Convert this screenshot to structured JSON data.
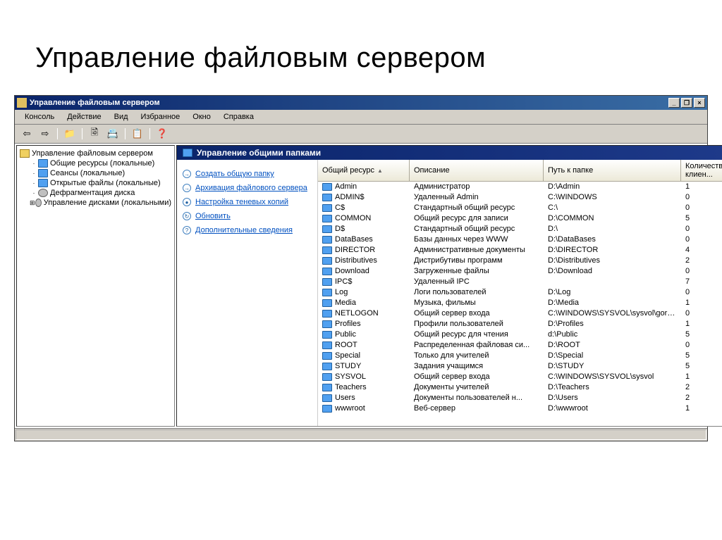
{
  "slide_title": "Управление файловым сервером",
  "window": {
    "title": "Управление файловым сервером",
    "min": "_",
    "max": "□",
    "restore": "❐",
    "close": "×"
  },
  "menu": {
    "console": "Консоль",
    "action": "Действие",
    "view": "Вид",
    "favorites": "Избранное",
    "window": "Окно",
    "help": "Справка"
  },
  "tree": {
    "root": "Управление файловым сервером",
    "items": [
      "Общие ресурсы (локальные)",
      "Сеансы (локальные)",
      "Открытые файлы (локальные)",
      "Дефрагментация диска",
      "Управление дисками (локальными)"
    ]
  },
  "content_header": "Управление общими папками",
  "actions": [
    {
      "icon": "→",
      "label": "Создать общую папку"
    },
    {
      "icon": "→",
      "label": "Архивация файлового сервера"
    },
    {
      "icon": "●",
      "label": "Настройка теневых копий"
    },
    {
      "icon": "↻",
      "label": "Обновить"
    },
    {
      "icon": "?",
      "label": "Дополнительные сведения"
    }
  ],
  "columns": {
    "name": "Общий ресурс",
    "desc": "Описание",
    "path": "Путь к папке",
    "count": "Количество клиен..."
  },
  "shares": [
    {
      "name": "Admin",
      "desc": "Администратор",
      "path": "D:\\Admin",
      "count": "1"
    },
    {
      "name": "ADMIN$",
      "desc": "Удаленный Admin",
      "path": "C:\\WINDOWS",
      "count": "0"
    },
    {
      "name": "C$",
      "desc": "Стандартный общий ресурс",
      "path": "C:\\",
      "count": "0"
    },
    {
      "name": "COMMON",
      "desc": "Общий ресурс для записи",
      "path": "D:\\COMMON",
      "count": "5"
    },
    {
      "name": "D$",
      "desc": "Стандартный общий ресурс",
      "path": "D:\\",
      "count": "0"
    },
    {
      "name": "DataBases",
      "desc": "Базы данных через WWW",
      "path": "D:\\DataBases",
      "count": "0"
    },
    {
      "name": "DIRECTOR",
      "desc": "Административные документы",
      "path": "D:\\DIRECTOR",
      "count": "4"
    },
    {
      "name": "Distributives",
      "desc": "Дистрибутивы программ",
      "path": "D:\\Distributives",
      "count": "2"
    },
    {
      "name": "Download",
      "desc": "Загруженные файлы",
      "path": "D:\\Download",
      "count": "0"
    },
    {
      "name": "IPC$",
      "desc": "Удаленный IPC",
      "path": "",
      "count": "7"
    },
    {
      "name": "Log",
      "desc": "Логи пользователей",
      "path": "D:\\Log",
      "count": "0"
    },
    {
      "name": "Media",
      "desc": "Музыка, фильмы",
      "path": "D:\\Media",
      "count": "1"
    },
    {
      "name": "NETLOGON",
      "desc": "Общий сервер входа",
      "path": "C:\\WINDOWS\\SYSVOL\\sysvol\\gorchak...",
      "count": "0"
    },
    {
      "name": "Profiles",
      "desc": "Профили пользователей",
      "path": "D:\\Profiles",
      "count": "1"
    },
    {
      "name": "Public",
      "desc": "Общий ресурс для чтения",
      "path": "d:\\Public",
      "count": "5"
    },
    {
      "name": "ROOT",
      "desc": "Распределенная файловая си...",
      "path": "D:\\ROOT",
      "count": "0"
    },
    {
      "name": "Special",
      "desc": "Только для учителей",
      "path": "D:\\Special",
      "count": "5"
    },
    {
      "name": "STUDY",
      "desc": "Задания учащимся",
      "path": "D:\\STUDY",
      "count": "5"
    },
    {
      "name": "SYSVOL",
      "desc": "Общий сервер входа",
      "path": "C:\\WINDOWS\\SYSVOL\\sysvol",
      "count": "1"
    },
    {
      "name": "Teachers",
      "desc": "Документы учителей",
      "path": "D:\\Teachers",
      "count": "2"
    },
    {
      "name": "Users",
      "desc": "Документы пользователей н...",
      "path": "D:\\Users",
      "count": "2"
    },
    {
      "name": "wwwroot",
      "desc": "Веб-сервер",
      "path": "D:\\wwwroot",
      "count": "1"
    }
  ]
}
